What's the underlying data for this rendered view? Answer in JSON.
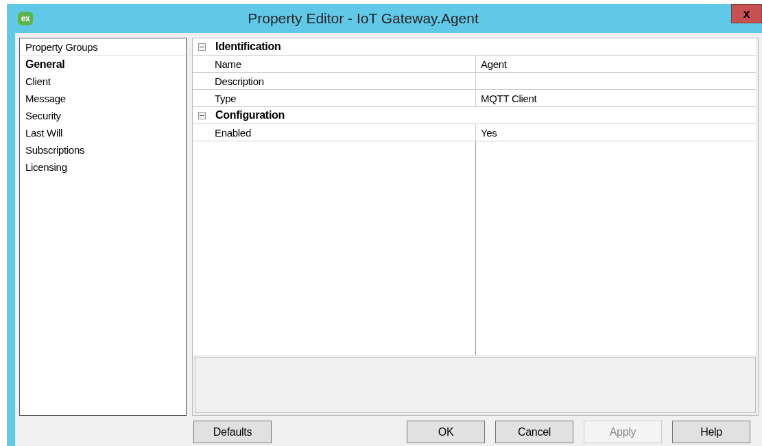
{
  "window": {
    "title": "Property Editor - IoT Gateway.Agent",
    "logo": "ex",
    "close": "x"
  },
  "property_groups": {
    "header": "Property Groups",
    "items": [
      {
        "label": "General",
        "selected": true
      },
      {
        "label": "Client",
        "selected": false
      },
      {
        "label": "Message",
        "selected": false
      },
      {
        "label": "Security",
        "selected": false
      },
      {
        "label": "Last Will",
        "selected": false
      },
      {
        "label": "Subscriptions",
        "selected": false
      },
      {
        "label": "Licensing",
        "selected": false
      }
    ]
  },
  "property_grid": {
    "categories": [
      {
        "name": "Identification",
        "expanded": true,
        "rows": [
          {
            "name": "Name",
            "value": "Agent"
          },
          {
            "name": "Description"
          },
          {
            "name": "Type",
            "value": "MQTT Client"
          }
        ]
      },
      {
        "name": "Configuration",
        "expanded": true,
        "rows": [
          {
            "name": "Enabled",
            "value": "Yes"
          }
        ]
      }
    ]
  },
  "buttons": [
    {
      "label": "Defaults",
      "disabled": false
    },
    {
      "label": "OK",
      "disabled": false
    },
    {
      "label": "Cancel",
      "disabled": false
    },
    {
      "label": "Apply",
      "disabled": true
    },
    {
      "label": "Help",
      "disabled": false
    }
  ]
}
